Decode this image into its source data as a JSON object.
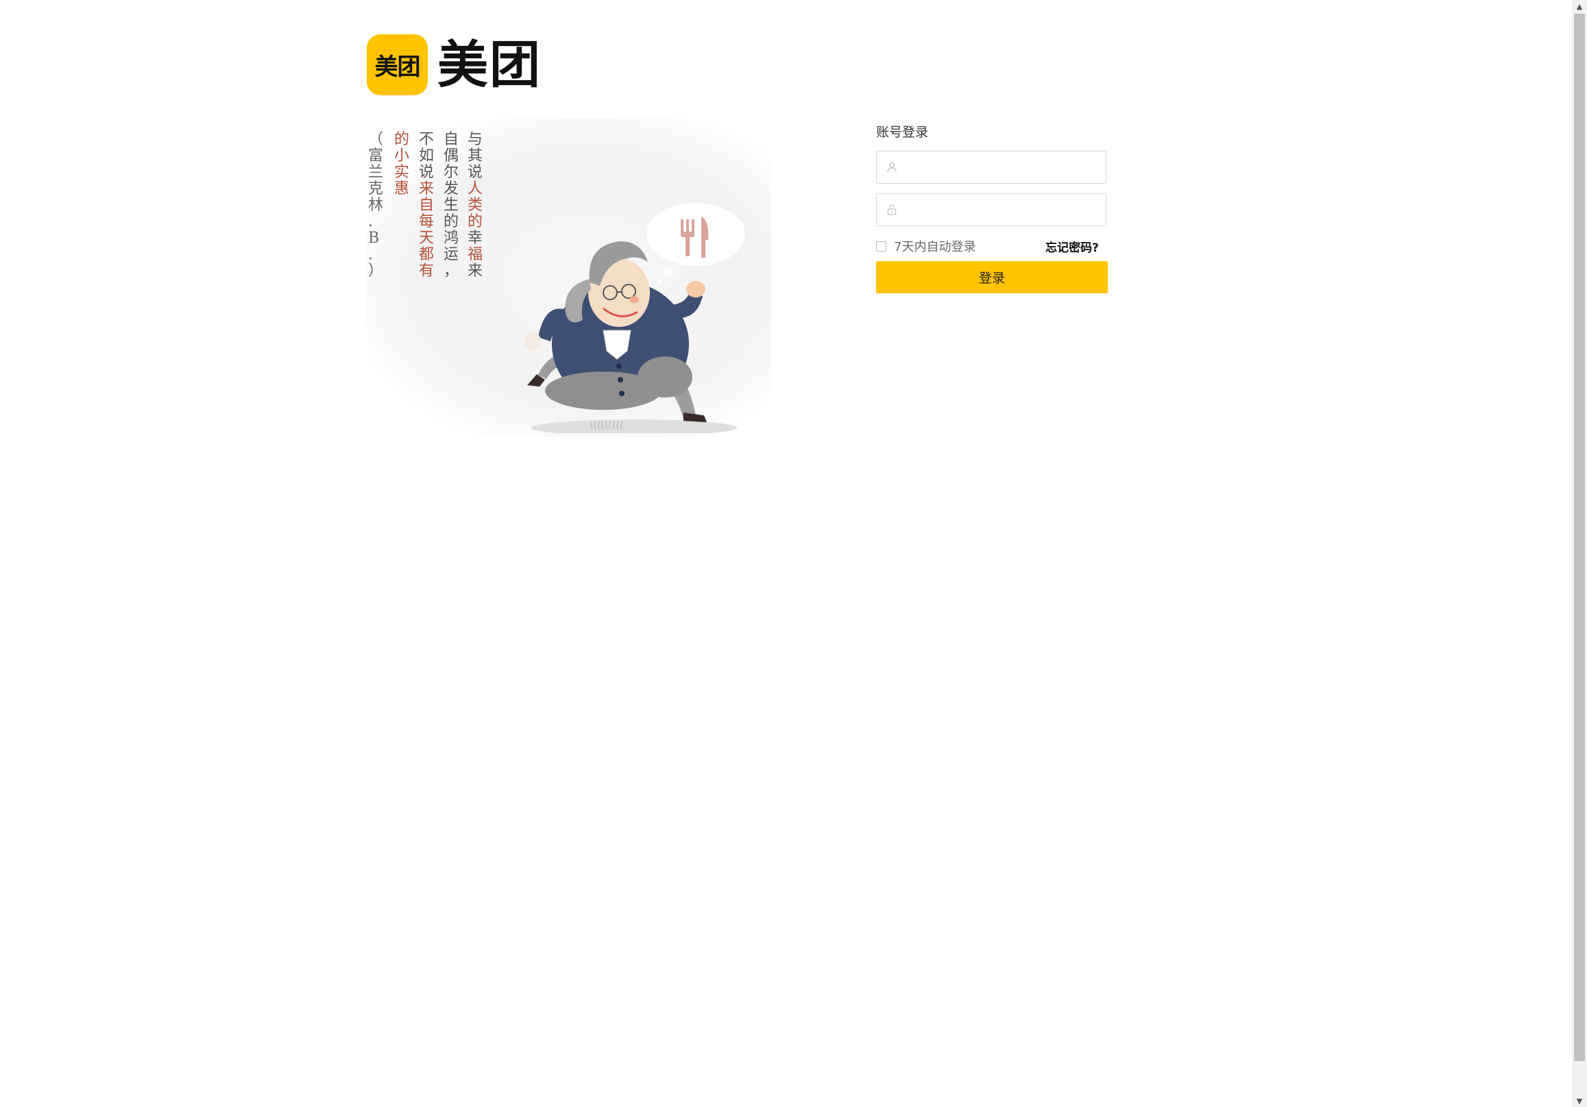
{
  "brand": {
    "badge_text": "美团",
    "wordmark": "美团",
    "accent_color": "#ffc300"
  },
  "illustration": {
    "poem_col1": [
      "与",
      "其",
      "说",
      "人",
      "类",
      "的",
      "幸",
      "福",
      "来"
    ],
    "poem_col2": [
      "自",
      "偶",
      "尔",
      "发",
      "生",
      "的",
      "鸿",
      "运",
      "，"
    ],
    "poem_col3": [
      "不",
      "如",
      "说",
      "来",
      "自",
      "每",
      "天",
      "都",
      "有"
    ],
    "poem_col4": [
      "的",
      "小",
      "实",
      "惠"
    ],
    "poem_col5": [
      "（",
      "富",
      "兰",
      "克",
      "林",
      ".",
      "B",
      ".",
      "）"
    ]
  },
  "login": {
    "title": "账号登录",
    "username_placeholder": "",
    "password_placeholder": "",
    "remember_label": "7天内自动登录",
    "forgot_label": "忘记密码?",
    "submit_label": "登录",
    "user_icon": "user-icon",
    "lock_icon": "lock-icon"
  }
}
